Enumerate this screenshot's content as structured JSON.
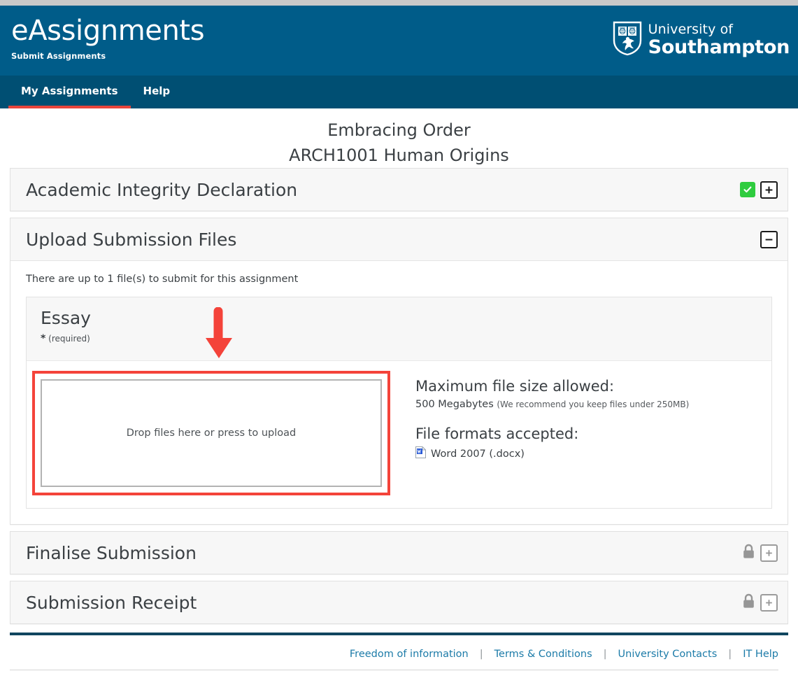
{
  "header": {
    "brand_title": "eAssignments",
    "brand_subtitle": "Submit Assignments",
    "university_line1": "University of",
    "university_line2": "Southampton",
    "shield_icon": "university-shield-icon",
    "bg_color": "#005c89"
  },
  "nav": {
    "bg_color": "#004f73",
    "active_underline_color": "#e8453c",
    "items": [
      {
        "label": "My Assignments",
        "active": true
      },
      {
        "label": "Help",
        "active": false
      }
    ]
  },
  "assignment": {
    "title": "Embracing Order",
    "module": "ARCH1001 Human Origins"
  },
  "sections": {
    "integrity": {
      "title": "Academic Integrity Declaration",
      "status_icon": "check-badge-icon",
      "status_color": "#2fcc3f",
      "toggle_icon": "plus-box-icon",
      "toggle_glyph": "+",
      "expanded": false
    },
    "upload": {
      "title": "Upload Submission Files",
      "toggle_icon": "minus-box-icon",
      "toggle_glyph": "−",
      "expanded": true,
      "note": "There are up to 1 file(s) to submit for this assignment",
      "file": {
        "name": "Essay",
        "required_star": "*",
        "required_label": "(required)",
        "dropzone_text": "Drop files here or press to upload",
        "max_size_heading": "Maximum file size allowed:",
        "max_size_value": "500 Megabytes",
        "max_size_note": "(We recommend you keep files under 250MB)",
        "formats_heading": "File formats accepted:",
        "formats": [
          {
            "icon": "word-document-icon",
            "label": "Word 2007 (.docx)"
          }
        ]
      },
      "annotation": {
        "type": "red-arrow-down",
        "color": "#f4433a",
        "highlight_color": "#f4433a"
      }
    },
    "finalise": {
      "title": "Finalise Submission",
      "status_icon": "lock-icon",
      "status_color": "#969696",
      "toggle_icon": "plus-box-icon",
      "toggle_glyph": "+",
      "locked": true
    },
    "receipt": {
      "title": "Submission Receipt",
      "status_icon": "lock-icon",
      "status_color": "#969696",
      "toggle_icon": "plus-box-icon",
      "toggle_glyph": "+",
      "locked": true
    }
  },
  "footer": {
    "links": [
      "Freedom of information",
      "Terms & Conditions",
      "University Contacts",
      "IT Help"
    ],
    "separator": "|",
    "link_color": "#1c7ba8",
    "rule_color": "#10465f"
  }
}
